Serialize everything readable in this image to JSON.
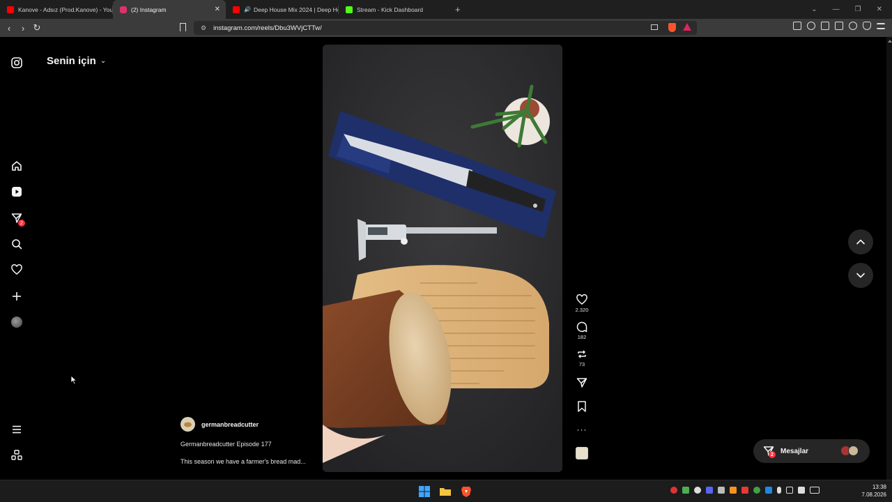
{
  "browser": {
    "tabs": [
      {
        "title": "Kanove - Adsız (Prod.Kanove) - YouTube",
        "favicon_color": "#ff0000",
        "active": false
      },
      {
        "title": "(2) Instagram",
        "favicon_color": "#e1306c",
        "active": true
      },
      {
        "title": "Deep House Mix 2024 | Deep House",
        "favicon_color": "#ff0000",
        "active": false,
        "audio": true
      },
      {
        "title": "Stream - Kick Dashboard",
        "favicon_color": "#53fc18",
        "active": false
      }
    ],
    "new_tab_symbol": "+",
    "url": "instagram.com/reels/Dbu3WVjCTTw/"
  },
  "feed": {
    "title": "Senin için"
  },
  "left_nav": {
    "notification_badge": "2"
  },
  "reel": {
    "author": "germanbreadcutter",
    "caption_title": "Germanbreadcutter Episode 177",
    "caption_desc": "This season we have a farmer's bread mad...",
    "likes": "2.320",
    "comments": "182",
    "reposts": "73"
  },
  "messages": {
    "label": "Mesajlar",
    "badge": "2"
  },
  "taskbar": {
    "time": "13:38",
    "date": "7.08.2026"
  },
  "colors": {
    "accent_red": "#ff3040",
    "pill_bg": "#262626"
  }
}
